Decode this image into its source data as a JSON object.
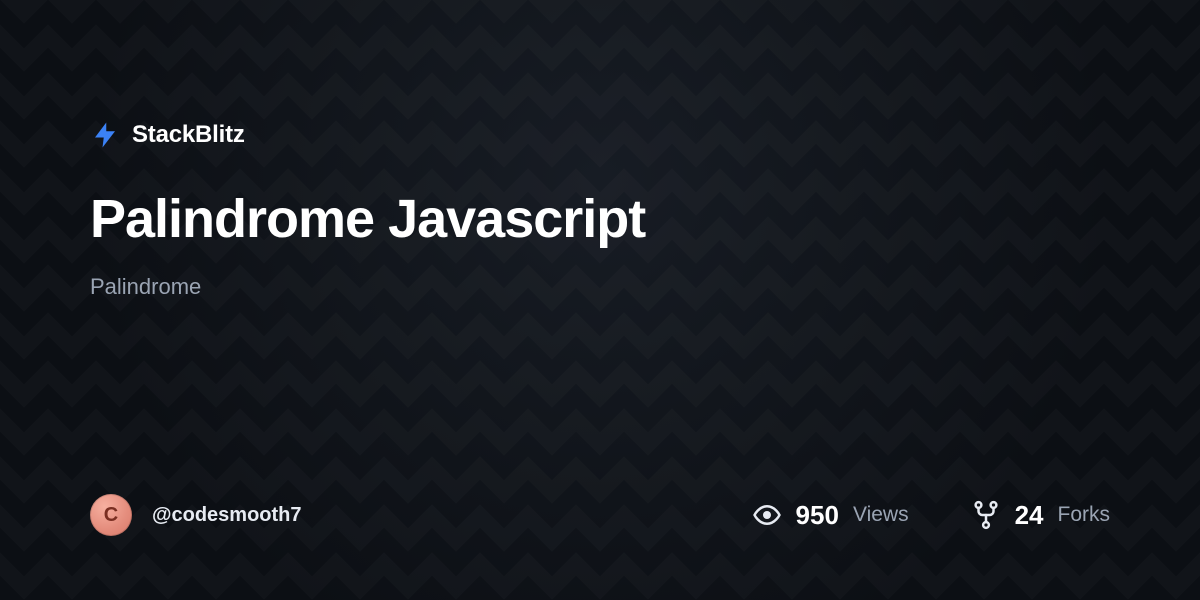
{
  "brand": {
    "name": "StackBlitz"
  },
  "project": {
    "title": "Palindrome Javascript",
    "subtitle": "Palindrome"
  },
  "author": {
    "initial": "C",
    "handle": "@codesmooth7"
  },
  "stats": {
    "views": {
      "value": "950",
      "label": "Views"
    },
    "forks": {
      "value": "24",
      "label": "Forks"
    }
  }
}
